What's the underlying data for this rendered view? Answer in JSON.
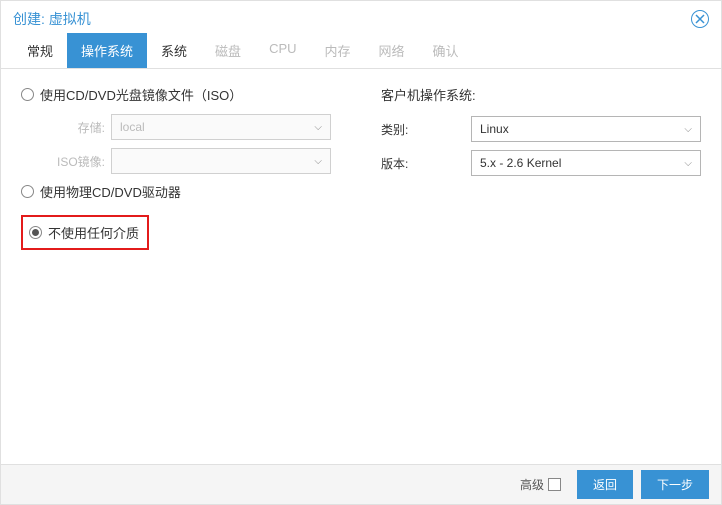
{
  "header": {
    "title": "创建: 虚拟机"
  },
  "tabs": {
    "general": "常规",
    "os": "操作系统",
    "system": "系统",
    "disk": "磁盘",
    "cpu": "CPU",
    "memory": "内存",
    "network": "网络",
    "confirm": "确认"
  },
  "left": {
    "radio_iso": "使用CD/DVD光盘镜像文件（ISO）",
    "storage_label": "存储:",
    "storage_value": "local",
    "iso_label": "ISO镜像:",
    "iso_value": "",
    "radio_physical": "使用物理CD/DVD驱动器",
    "radio_none": "不使用任何介质"
  },
  "right": {
    "title": "客户机操作系统:",
    "type_label": "类别:",
    "type_value": "Linux",
    "version_label": "版本:",
    "version_value": "5.x - 2.6 Kernel"
  },
  "footer": {
    "advanced": "高级",
    "back": "返回",
    "next": "下一步"
  }
}
